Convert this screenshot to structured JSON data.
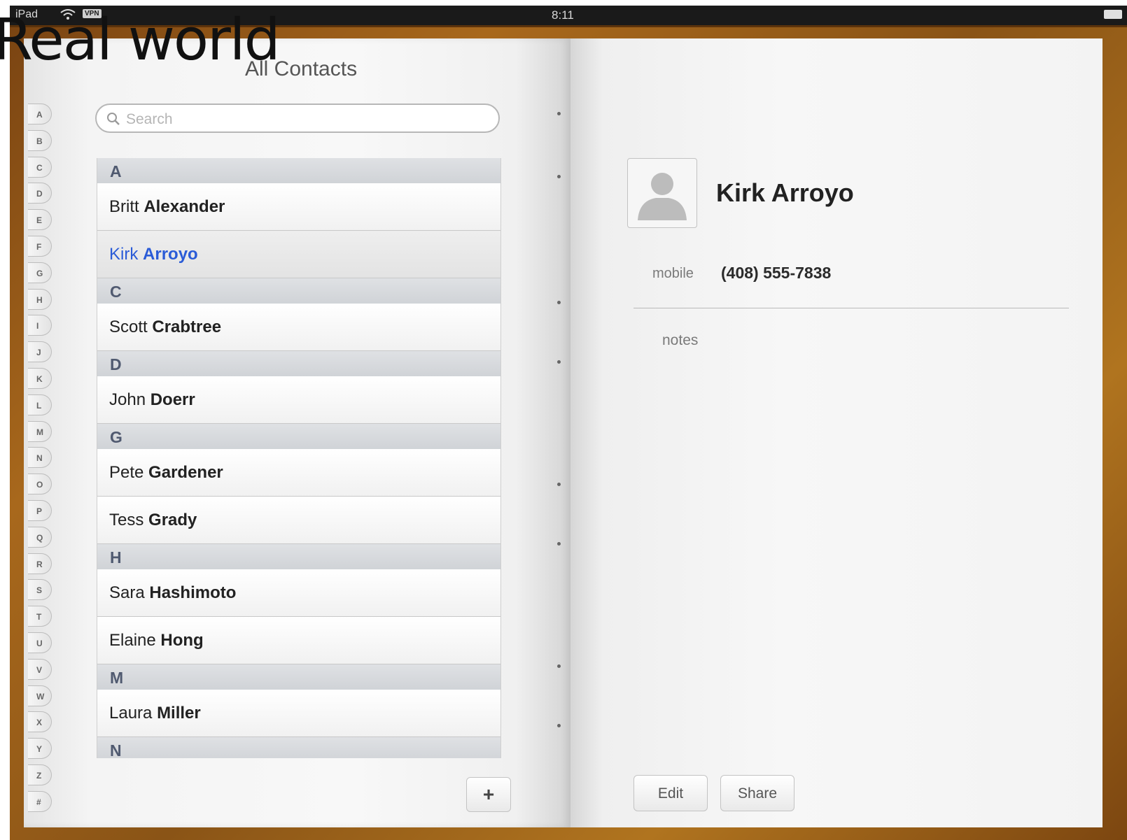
{
  "overlay": {
    "title": "Real world"
  },
  "status_bar": {
    "carrier": "iPad",
    "wifi_icon": "wifi-icon",
    "vpn": "VPN",
    "time": "8:11",
    "battery_icon": "battery-icon"
  },
  "left_page": {
    "title": "All Contacts",
    "index_letters": [
      "A",
      "B",
      "C",
      "D",
      "E",
      "F",
      "G",
      "H",
      "I",
      "J",
      "K",
      "L",
      "M",
      "N",
      "O",
      "P",
      "Q",
      "R",
      "S",
      "T",
      "U",
      "V",
      "W",
      "X",
      "Y",
      "Z",
      "#"
    ],
    "search": {
      "placeholder": "Search",
      "icon": "search-icon"
    },
    "sections": [
      {
        "letter": "A",
        "contacts": [
          {
            "first": "Britt",
            "last": "Alexander",
            "selected": false
          },
          {
            "first": "Kirk",
            "last": "Arroyo",
            "selected": true
          }
        ]
      },
      {
        "letter": "C",
        "contacts": [
          {
            "first": "Scott",
            "last": "Crabtree",
            "selected": false
          }
        ]
      },
      {
        "letter": "D",
        "contacts": [
          {
            "first": "John",
            "last": "Doerr",
            "selected": false
          }
        ]
      },
      {
        "letter": "G",
        "contacts": [
          {
            "first": "Pete",
            "last": "Gardener",
            "selected": false
          },
          {
            "first": "Tess",
            "last": "Grady",
            "selected": false
          }
        ]
      },
      {
        "letter": "H",
        "contacts": [
          {
            "first": "Sara",
            "last": "Hashimoto",
            "selected": false
          },
          {
            "first": "Elaine",
            "last": "Hong",
            "selected": false
          }
        ]
      },
      {
        "letter": "M",
        "contacts": [
          {
            "first": "Laura",
            "last": "Miller",
            "selected": false
          }
        ]
      },
      {
        "letter": "N",
        "contacts": []
      }
    ],
    "add_button": {
      "label": "+"
    }
  },
  "right_page": {
    "avatar_icon": "person-silhouette-icon",
    "name": "Kirk Arroyo",
    "phone": {
      "label": "mobile",
      "value": "(408) 555-7838"
    },
    "notes_label": "notes",
    "buttons": {
      "edit": "Edit",
      "share": "Share"
    }
  },
  "colors": {
    "selected_text": "#2a5bd7",
    "section_header_text": "#505a70",
    "leather": "#8a5416"
  }
}
